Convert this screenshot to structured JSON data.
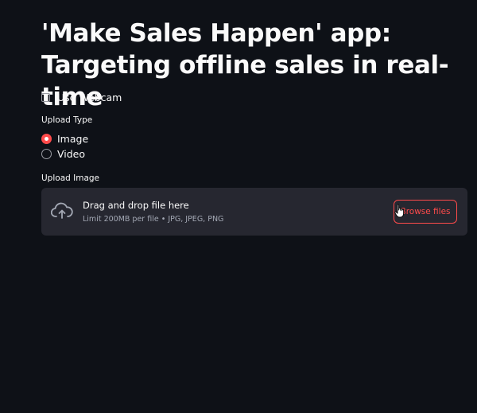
{
  "page": {
    "title": "'Make Sales Happen' app: Targeting offline sales in real-time"
  },
  "webcam": {
    "label": "Use Webcam",
    "checked": false
  },
  "upload_type": {
    "label": "Upload Type",
    "options": [
      {
        "label": "Image",
        "selected": true
      },
      {
        "label": "Video",
        "selected": false
      }
    ]
  },
  "upload_image": {
    "label": "Upload Image",
    "dropzone_main": "Drag and drop file here",
    "dropzone_sub": "Limit 200MB per file • JPG, JPEG, PNG",
    "browse_label": "Browse files",
    "icon": "cloud-upload-icon"
  },
  "theme": {
    "background": "#0e1117",
    "surface": "#262730",
    "accent": "#ff4b4b",
    "text": "#fafafa",
    "muted_text": "#a3a8b4"
  }
}
